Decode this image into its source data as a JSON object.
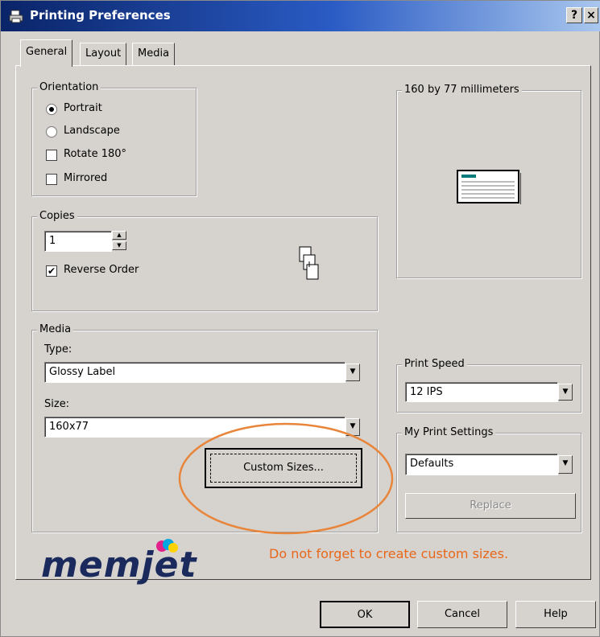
{
  "window": {
    "title": "Printing Preferences"
  },
  "title_buttons": {
    "help": "?",
    "close": "×"
  },
  "tabs": [
    {
      "label": "General",
      "active": true
    },
    {
      "label": "Layout",
      "active": false
    },
    {
      "label": "Media",
      "active": false
    }
  ],
  "orientation": {
    "legend": "Orientation",
    "portrait": {
      "label": "Portrait",
      "selected": true
    },
    "landscape": {
      "label": "Landscape",
      "selected": false
    },
    "rotate": {
      "label": "Rotate 180°",
      "checked": false
    },
    "mirrored": {
      "label": "Mirrored",
      "checked": false
    }
  },
  "copies": {
    "legend": "Copies",
    "value": "1",
    "reverse_order": {
      "label": "Reverse Order",
      "checked": true,
      "mark": "✔"
    }
  },
  "preview": {
    "legend": "160 by 77 millimeters"
  },
  "media": {
    "legend": "Media",
    "type_label": "Type:",
    "type_value": "Glossy Label",
    "size_label": "Size:",
    "size_value": "160x77",
    "custom_sizes_label": "Custom Sizes..."
  },
  "print_speed": {
    "legend": "Print Speed",
    "value": "12 IPS"
  },
  "my_print_settings": {
    "legend": "My Print Settings",
    "value": "Defaults",
    "replace_label": "Replace"
  },
  "annotation": {
    "text": "Do not forget to create custom sizes.",
    "color": "#e8671b"
  },
  "logo": {
    "text": "memjet"
  },
  "footer": {
    "ok": "OK",
    "cancel": "Cancel",
    "help": "Help"
  }
}
